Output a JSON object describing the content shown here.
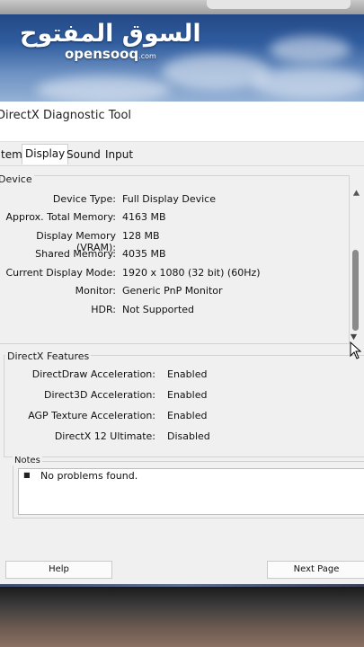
{
  "watermark": {
    "arabic": "السوق المفتوح",
    "latin": "opensooq",
    "suffix": ".com"
  },
  "window": {
    "title": "DirectX Diagnostic Tool"
  },
  "tabs": [
    {
      "label": "tem"
    },
    {
      "label": "Display"
    },
    {
      "label": "Sound"
    },
    {
      "label": "Input"
    }
  ],
  "device": {
    "group_label": "Device",
    "rows": [
      {
        "label": "Device Type:",
        "value": "Full Display Device"
      },
      {
        "label": "Approx. Total Memory:",
        "value": "4163 MB"
      },
      {
        "label": "Display Memory (VRAM):",
        "value": "128 MB"
      },
      {
        "label": "Shared Memory:",
        "value": "4035 MB"
      },
      {
        "label": "Current Display Mode:",
        "value": "1920 x 1080 (32 bit) (60Hz)"
      },
      {
        "label": "Monitor:",
        "value": "Generic PnP Monitor"
      },
      {
        "label": "HDR:",
        "value": "Not Supported"
      }
    ]
  },
  "directx": {
    "group_label": "DirectX Features",
    "rows": [
      {
        "label": "DirectDraw Acceleration:",
        "value": "Enabled"
      },
      {
        "label": "Direct3D Acceleration:",
        "value": "Enabled"
      },
      {
        "label": "AGP Texture Acceleration:",
        "value": "Enabled"
      },
      {
        "label": "DirectX 12 Ultimate:",
        "value": "Disabled"
      }
    ]
  },
  "notes": {
    "group_label": "Notes",
    "items": [
      "No problems found."
    ]
  },
  "buttons": {
    "help": "Help",
    "next_page": "Next Page"
  },
  "colors": {
    "dialog_bg": "#f0f0f0",
    "wallpaper_blue": "#2f5c9e"
  }
}
